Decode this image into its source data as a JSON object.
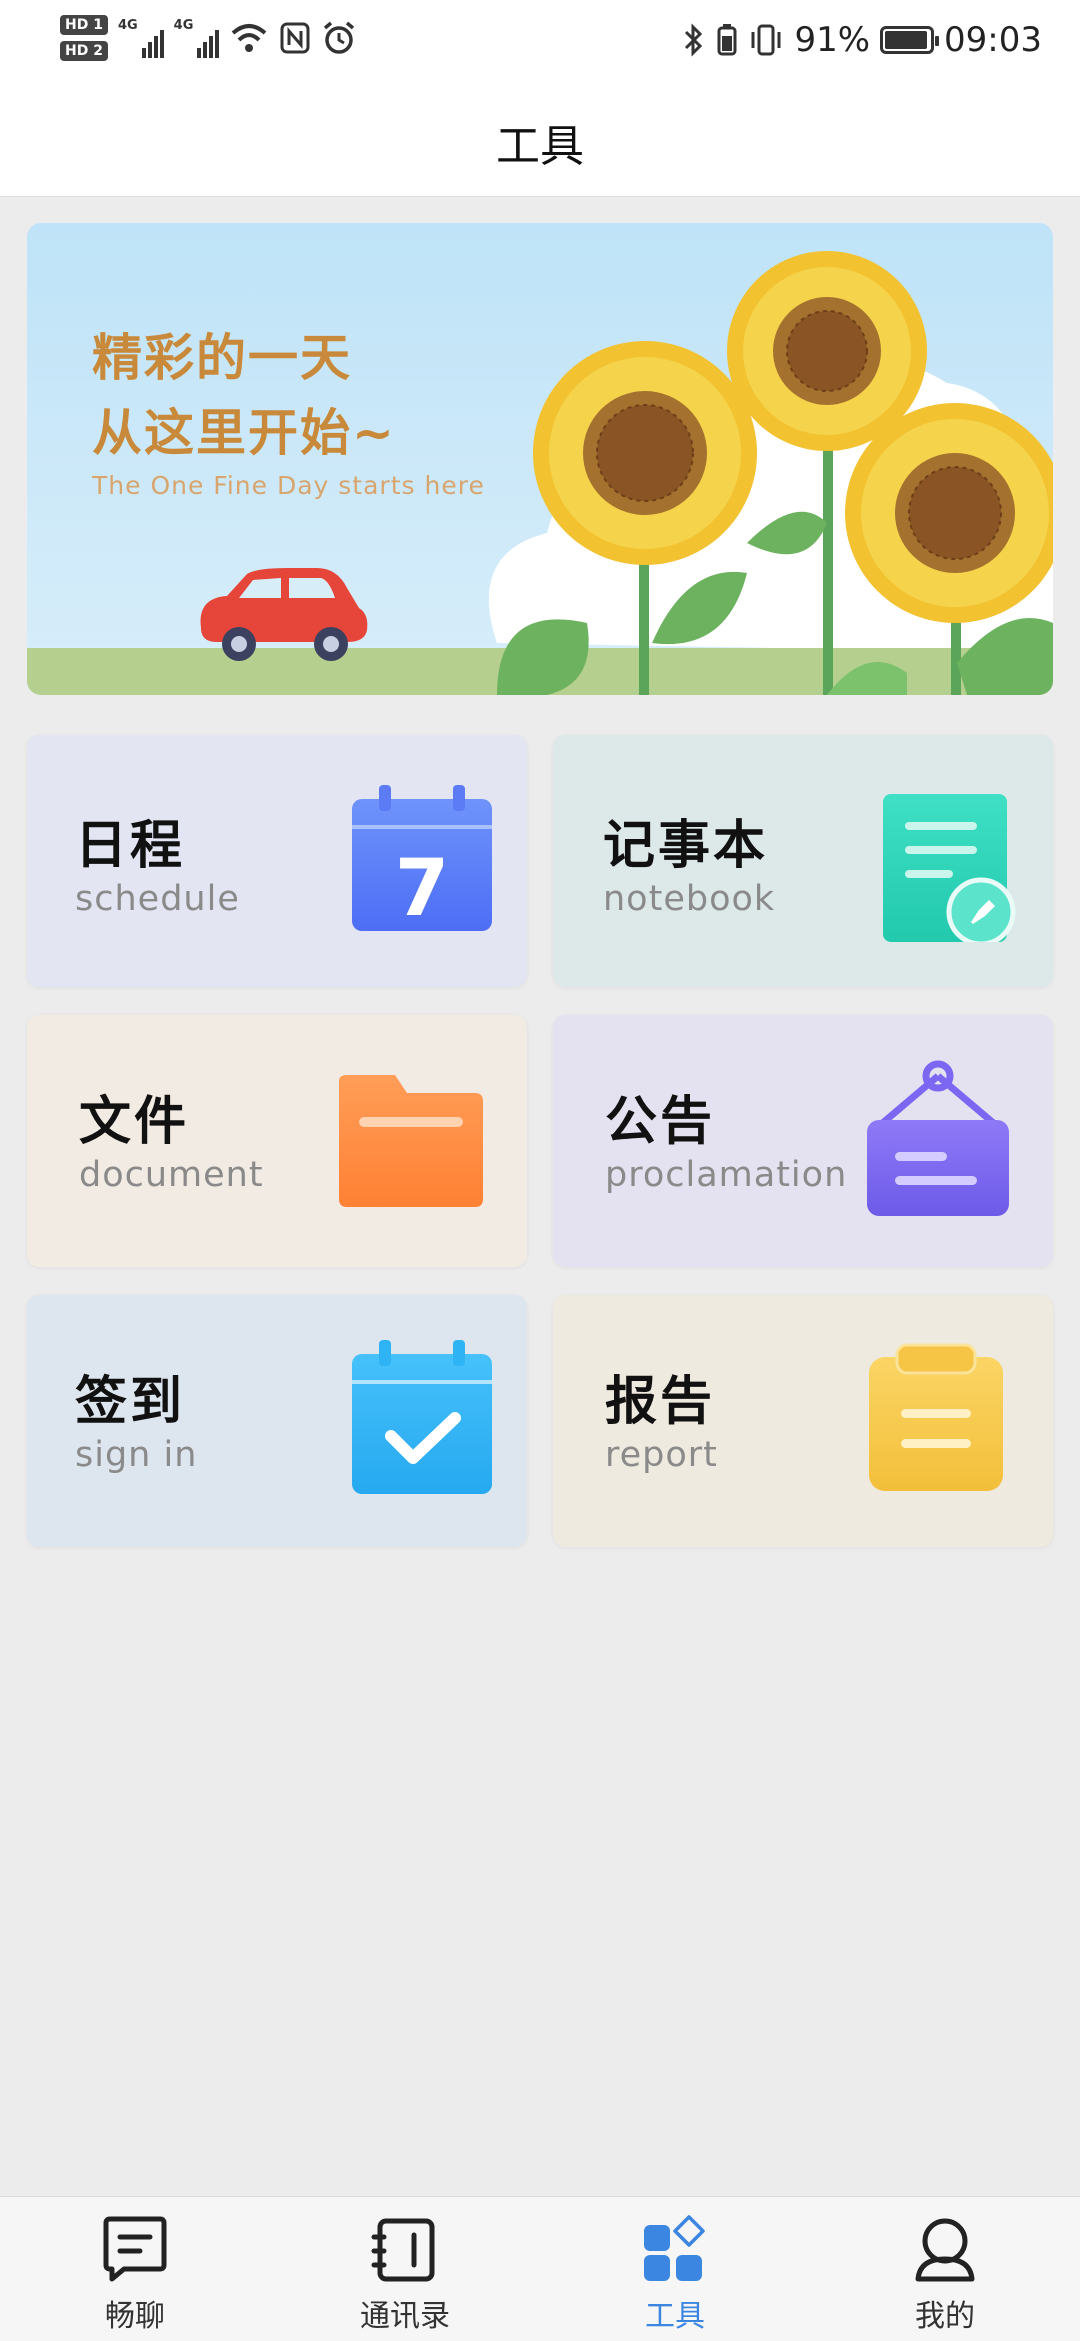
{
  "status_bar": {
    "sim1": "HD 1",
    "sim2": "HD 2",
    "net1": "4G",
    "net2": "4G",
    "battery_pct": "91%",
    "time": "09:03"
  },
  "header": {
    "title": "工具"
  },
  "banner": {
    "line1": "精彩的一天",
    "line2": "从这里开始~",
    "line3": "The One Fine Day starts here"
  },
  "tiles": [
    {
      "title": "日程",
      "subtitle": "schedule",
      "icon": "calendar-icon",
      "color": "#5b7cf5",
      "icon_text": "7"
    },
    {
      "title": "记事本",
      "subtitle": "notebook",
      "icon": "notebook-icon",
      "color": "#2fd3b8"
    },
    {
      "title": "文件",
      "subtitle": "document",
      "icon": "folder-icon",
      "color": "#ff8a3d"
    },
    {
      "title": "公告",
      "subtitle": "proclamation",
      "icon": "announcement-board-icon",
      "color": "#7b67f2"
    },
    {
      "title": "签到",
      "subtitle": "sign in",
      "icon": "checkin-calendar-icon",
      "color": "#2eb4f5"
    },
    {
      "title": "报告",
      "subtitle": "report",
      "icon": "clipboard-icon",
      "color": "#f6c546"
    }
  ],
  "nav": {
    "items": [
      {
        "label": "畅聊",
        "icon": "chat-icon"
      },
      {
        "label": "通讯录",
        "icon": "contacts-icon"
      },
      {
        "label": "工具",
        "icon": "tools-icon",
        "active": true
      },
      {
        "label": "我的",
        "icon": "profile-icon"
      }
    ],
    "active_color": "#3b86e0"
  }
}
